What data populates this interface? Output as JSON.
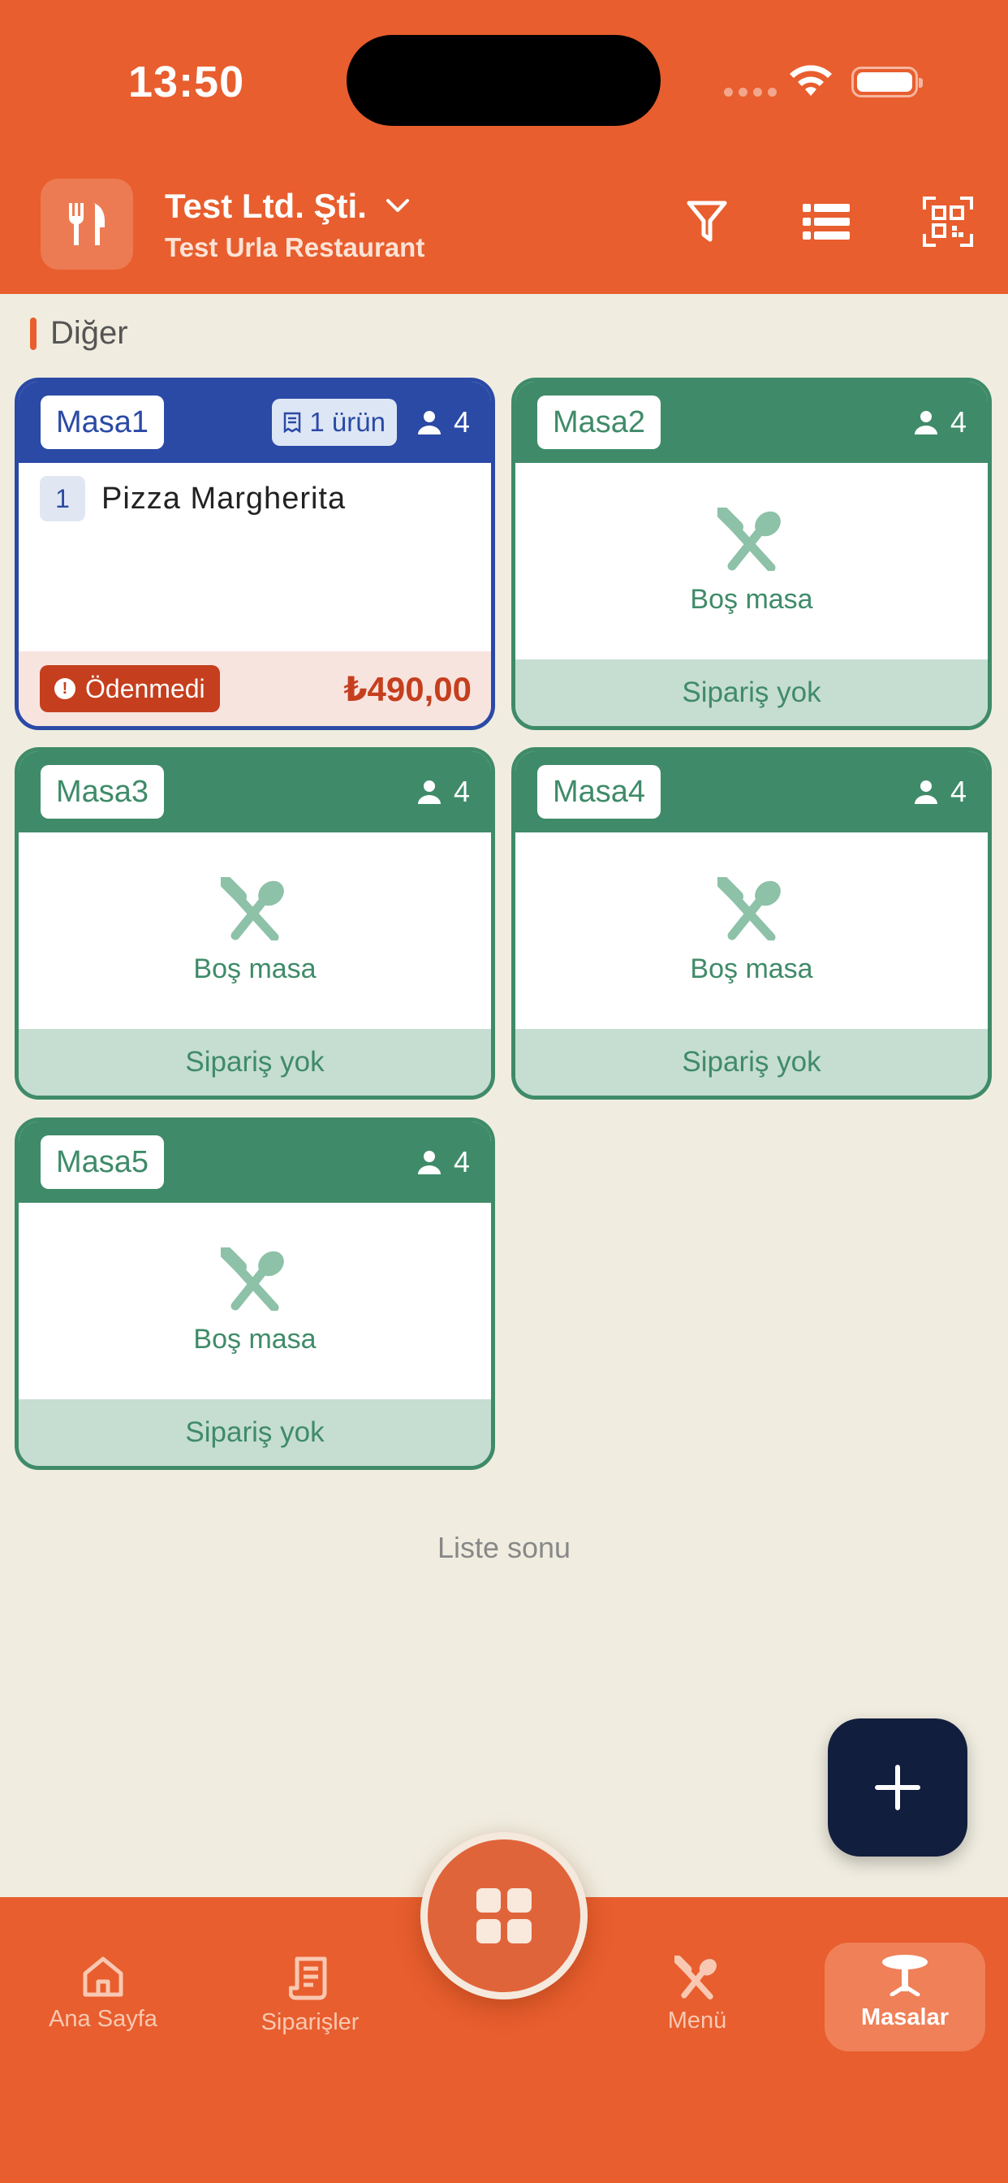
{
  "status_bar": {
    "time": "13:50"
  },
  "header": {
    "company": "Test Ltd. Şti.",
    "restaurant": "Test Urla Restaurant",
    "icons": [
      "utensils-icon",
      "chevron-down-icon",
      "filter-icon",
      "list-icon",
      "qr-code-icon"
    ]
  },
  "section": {
    "label": "Diğer"
  },
  "tables": [
    {
      "name": "Masa1",
      "guests": "4",
      "items_label": "1 ürün",
      "order": {
        "qty": "1",
        "product": "Pizza Margherita"
      },
      "status": "Ödenmedi",
      "total": "₺490,00"
    },
    {
      "name": "Masa2",
      "guests": "4",
      "empty_label": "Boş masa",
      "footer": "Sipariş yok"
    },
    {
      "name": "Masa3",
      "guests": "4",
      "empty_label": "Boş masa",
      "footer": "Sipariş yok"
    },
    {
      "name": "Masa4",
      "guests": "4",
      "empty_label": "Boş masa",
      "footer": "Sipariş yok"
    },
    {
      "name": "Masa5",
      "guests": "4",
      "empty_label": "Boş masa",
      "footer": "Sipariş yok"
    }
  ],
  "list_end": "Liste sonu",
  "nav": {
    "home": "Ana Sayfa",
    "orders": "Siparişler",
    "menu": "Menü",
    "tables": "Masalar"
  },
  "colors": {
    "brand": "#E85E2E",
    "green": "#3F8B69",
    "blue": "#2B4AA6",
    "background": "#F0EDE0",
    "fab": "#121E3D"
  }
}
